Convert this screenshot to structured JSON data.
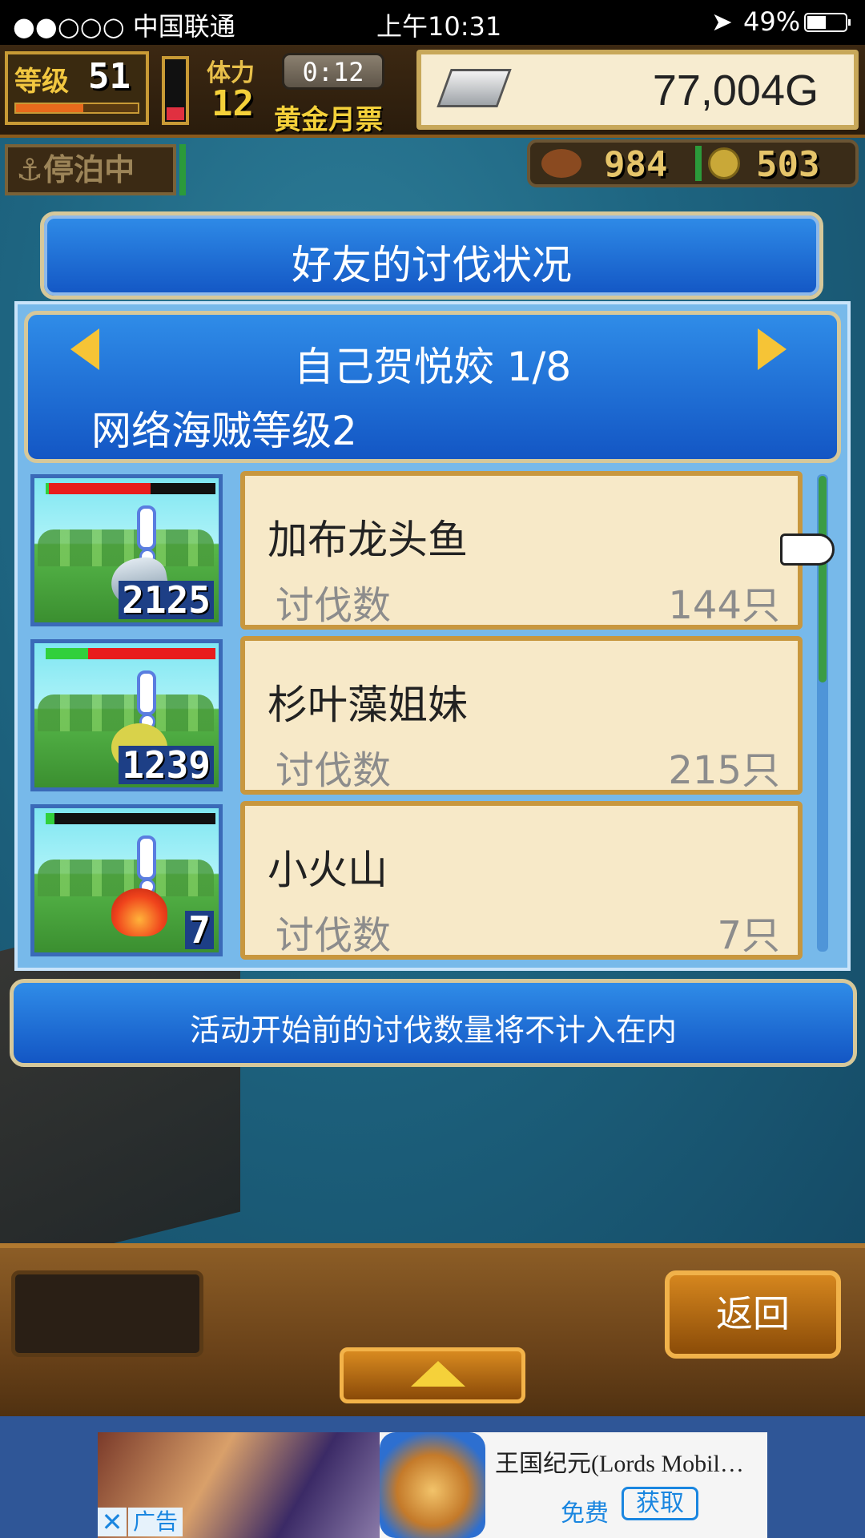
{
  "status_bar": {
    "carrier": "●●○○○ 中国联通",
    "time": "上午10:31",
    "battery_percent": "49%",
    "battery_level": 0.49
  },
  "hud": {
    "level_label": "等级",
    "level": "51",
    "level_progress": 0.55,
    "stamina_label": "体力",
    "stamina": "12",
    "stamina_gauge": 0.2,
    "timer": "0:12",
    "ticket_label": "黄金月票",
    "gold": "77,004G",
    "dock_status": "停泊中",
    "food": "984",
    "coins": "503"
  },
  "dialog": {
    "title": "好友的讨伐状况",
    "friend_name": "自己贺悦姣 1/8",
    "pirate_level": "网络海贼等级2",
    "rows": [
      {
        "name": "加布龙头鱼",
        "label": "讨伐数",
        "value": "144只",
        "count": "2125",
        "hp_green": 0.02,
        "hp_red": 0.62,
        "monster_icon": "fish-monster-icon"
      },
      {
        "name": "杉叶藻姐妹",
        "label": "讨伐数",
        "value": "215只",
        "count": "1239",
        "hp_green": 0.25,
        "hp_red": 1.0,
        "monster_icon": "seaweed-girl-icon"
      },
      {
        "name": "小火山",
        "label": "讨伐数",
        "value": "7只",
        "count": "7",
        "hp_green": 0.05,
        "hp_red": 0.0,
        "monster_icon": "fire-monster-icon"
      }
    ],
    "notice": "活动开始前的讨伐数量将不计入在内"
  },
  "bottom_bar": {
    "back_label": "返回"
  },
  "ad": {
    "tag": "广告",
    "close": "✕",
    "title": "王国纪元(Lords Mobil…",
    "free": "免费",
    "get": "获取"
  },
  "colors": {
    "panel_blue": "#1f6fd8",
    "card_bg": "#f7e9c8",
    "card_border": "#c8973e",
    "gold_text": "#f5d13a",
    "hp_red": "#e81c1c",
    "hp_green": "#31d03c"
  }
}
